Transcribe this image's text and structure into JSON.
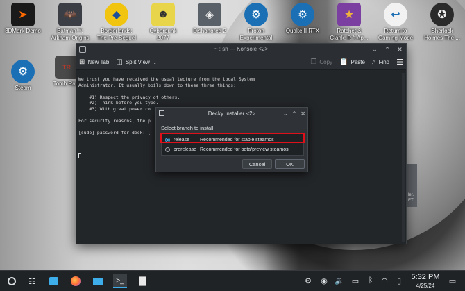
{
  "desktop": {
    "icons": [
      {
        "label": "3DMark Demo"
      },
      {
        "label": "Batman™:\nArkham Origins"
      },
      {
        "label": "Borderlands:\nThe Pre-Sequel"
      },
      {
        "label": "Cyberpunk\n2077"
      },
      {
        "label": "Dishonored 2"
      },
      {
        "label": "Proton\nExperimental"
      },
      {
        "label": "Quake II RTX"
      },
      {
        "label": "Ratchet &\nClank: Rift Ap..."
      },
      {
        "label": "Return to\nGaming Mode"
      },
      {
        "label": "Sherlock\nHolmes The ..."
      },
      {
        "label": "Steam"
      },
      {
        "label": "Tomb Ra..."
      }
    ]
  },
  "konsole": {
    "title": "~ : sh — Konsole <2>",
    "toolbar": {
      "new_tab": "New Tab",
      "split_view": "Split View",
      "copy": "Copy",
      "paste": "Paste",
      "find": "Find"
    },
    "lines": [
      "We trust you have received the usual lecture from the local System",
      "Administrator. It usually boils down to these three things:",
      "",
      "    #1) Respect the privacy of others.",
      "    #2) Think before you type.",
      "    #3) With great power co",
      "",
      "For security reasons, the p",
      "",
      "[sudo] password for deck: [",
      "",
      "",
      ""
    ]
  },
  "dialog": {
    "title": "Decky Installer <2>",
    "prompt": "Select branch to install:",
    "options": [
      {
        "name": "release",
        "desc": "Recommended for stable steamos"
      },
      {
        "name": "prerelease",
        "desc": "Recommended for beta/preview steamos"
      }
    ],
    "cancel": "Cancel",
    "ok": "OK"
  },
  "bg_window": {
    "text": "ler.\nET."
  },
  "taskbar": {
    "time": "5:32 PM",
    "date": "4/25/24"
  },
  "colors": {
    "accent": "#3daee9",
    "highlight": "#e0101a"
  }
}
